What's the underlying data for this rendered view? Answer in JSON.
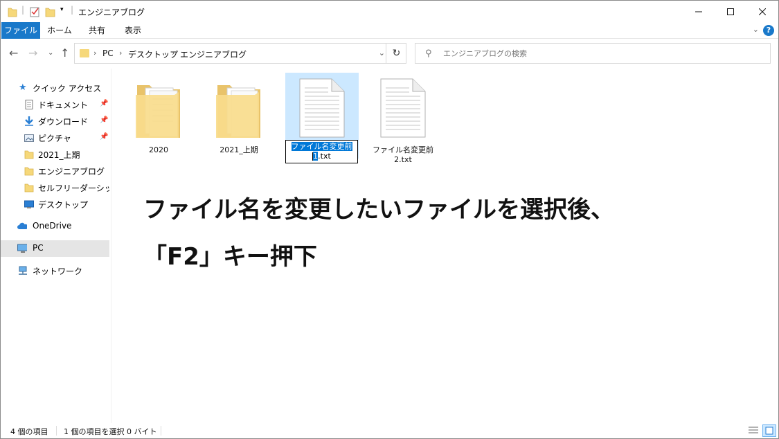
{
  "window": {
    "title": "エンジニアブログ",
    "controls": {
      "minimize": "—",
      "maximize": "☐",
      "close": "✕"
    }
  },
  "ribbon": {
    "tabs": [
      {
        "label": "ファイル"
      },
      {
        "label": "ホーム"
      },
      {
        "label": "共有"
      },
      {
        "label": "表示"
      }
    ],
    "help_label": "?"
  },
  "address": {
    "crumbs": [
      "PC",
      "デスクトップ",
      "エンジニアブログ"
    ]
  },
  "search": {
    "placeholder": "エンジニアブログの検索"
  },
  "sidebar": {
    "items": [
      {
        "label": "クイック アクセス",
        "icon": "star-icon"
      },
      {
        "label": "ドキュメント",
        "icon": "document-icon",
        "pinned": true
      },
      {
        "label": "ダウンロード",
        "icon": "download-icon",
        "pinned": true
      },
      {
        "label": "ピクチャ",
        "icon": "picture-icon",
        "pinned": true
      },
      {
        "label": "2021_上期",
        "icon": "folder-icon"
      },
      {
        "label": "エンジニアブログ",
        "icon": "folder-icon"
      },
      {
        "label": "セルフリーダーシップ研修",
        "icon": "folder-icon"
      },
      {
        "label": "デスクトップ",
        "icon": "desktop-icon"
      },
      {
        "label": "OneDrive",
        "icon": "cloud-icon"
      },
      {
        "label": "PC",
        "icon": "computer-icon",
        "selected": true
      },
      {
        "label": "ネットワーク",
        "icon": "network-icon"
      }
    ]
  },
  "files": [
    {
      "name": "2020",
      "type": "folder"
    },
    {
      "name": "2021_上期",
      "type": "folder"
    },
    {
      "name_line1": "ファイル名変更前",
      "name_line2": "1.txt",
      "type": "text",
      "selected": true,
      "renaming": true
    },
    {
      "name_line1": "ファイル名変更前",
      "name_line2": "2.txt",
      "type": "text"
    }
  ],
  "annotation": {
    "line1": "ファイル名を変更したいファイルを選択後、",
    "line2": "「F2」キー押下"
  },
  "status": {
    "item_count": "4 個の項目",
    "selection": "1 個の項目を選択  0 バイト"
  },
  "colors": {
    "accent": "#1979ca",
    "selection_bg": "#cce8ff",
    "highlight": "#0078d7",
    "folder": "#f6d87a"
  }
}
